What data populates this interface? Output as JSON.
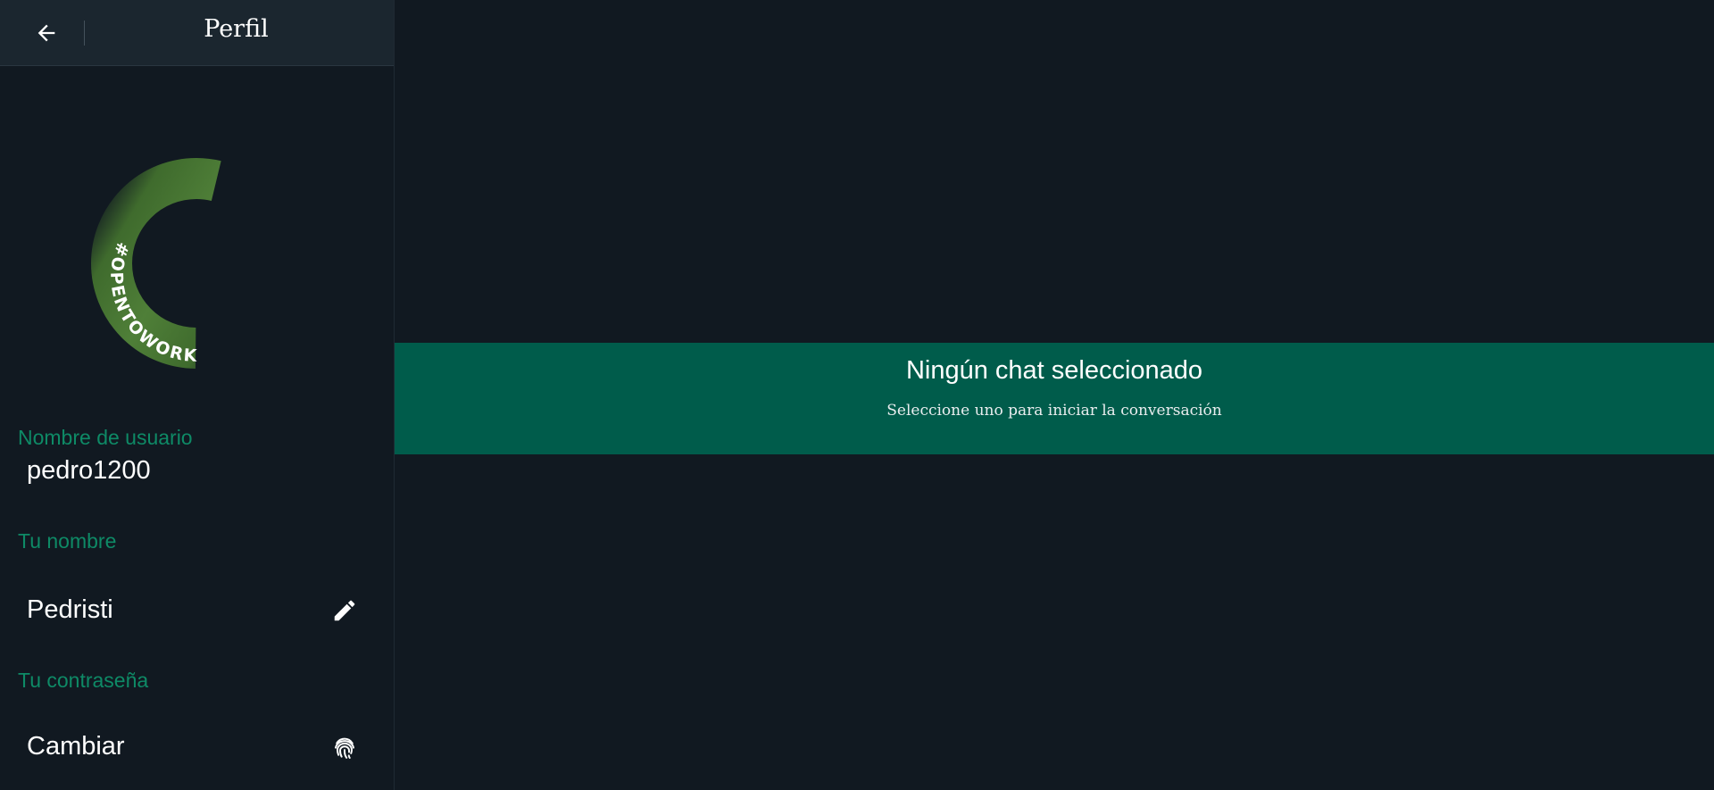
{
  "sidebar": {
    "header": {
      "title": "Perfil",
      "back_icon": "arrow-left-icon"
    },
    "avatar": {
      "badge_text": "#OPENTOWORK",
      "ring_color": "#4a7a35"
    },
    "fields": {
      "username": {
        "label": "Nombre de usuario",
        "value": "pedro1200"
      },
      "name": {
        "label": "Tu nombre",
        "value": "Pedristi",
        "action_icon": "pencil-icon"
      },
      "password": {
        "label": "Tu contraseña",
        "value": "Cambiar",
        "action_icon": "fingerprint-icon"
      }
    }
  },
  "main": {
    "banner": {
      "title": "Ningún chat seleccionado",
      "subtitle": "Seleccione uno para iniciar la conversación"
    }
  },
  "colors": {
    "background": "#111921",
    "header": "#1b262f",
    "accent_label": "#0e8a66",
    "banner": "#005c4b"
  }
}
